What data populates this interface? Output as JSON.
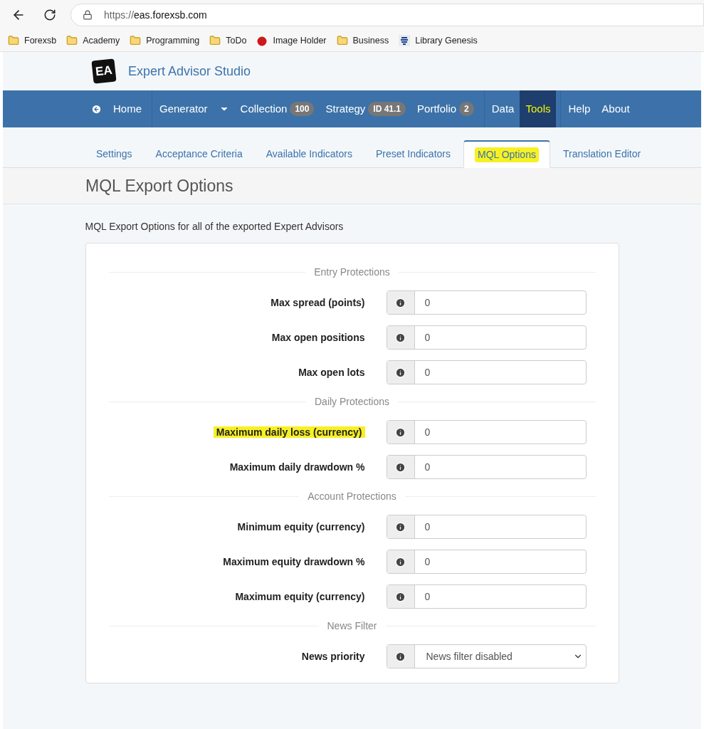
{
  "browser": {
    "url_scheme": "https://",
    "url_host": "eas.forexsb.com",
    "bookmarks": [
      {
        "label": "Forexsb",
        "kind": "folder"
      },
      {
        "label": "Academy",
        "kind": "folder"
      },
      {
        "label": "Programming",
        "kind": "folder"
      },
      {
        "label": "ToDo",
        "kind": "folder"
      },
      {
        "label": "Image Holder",
        "kind": "tomato"
      },
      {
        "label": "Business",
        "kind": "folder"
      },
      {
        "label": "Library Genesis",
        "kind": "stack"
      }
    ]
  },
  "app": {
    "title": "Expert Advisor Studio",
    "logo": "EA"
  },
  "nav": [
    [
      {
        "label": "Home",
        "kind": "back",
        "active": false,
        "highlighted": false
      }
    ],
    [
      {
        "label": "Generator",
        "dropdown": true,
        "active": false,
        "highlighted": false
      },
      {
        "label": "Collection",
        "badge": "100",
        "active": false,
        "highlighted": false
      },
      {
        "label": "Strategy",
        "badge": "ID 41.1",
        "active": false,
        "highlighted": false
      },
      {
        "label": "Portfolio",
        "badge": "2",
        "active": false,
        "highlighted": false
      }
    ],
    [
      {
        "label": "Data",
        "active": false,
        "highlighted": false
      },
      {
        "label": "Tools",
        "active": true,
        "highlighted": true
      }
    ],
    [
      {
        "label": "Help",
        "active": false,
        "highlighted": false
      },
      {
        "label": "About",
        "active": false,
        "highlighted": false
      }
    ]
  ],
  "tabs": [
    {
      "label": "Settings",
      "selected": false,
      "highlighted": false
    },
    {
      "label": "Acceptance Criteria",
      "selected": false,
      "highlighted": false
    },
    {
      "label": "Available Indicators",
      "selected": false,
      "highlighted": false
    },
    {
      "label": "Preset Indicators",
      "selected": false,
      "highlighted": false
    },
    {
      "label": "MQL Options",
      "selected": true,
      "highlighted": true
    },
    {
      "label": "Translation Editor",
      "selected": false,
      "highlighted": false
    }
  ],
  "page_title": "MQL Export Options",
  "description": "MQL Export Options for all of the exported Expert Advisors",
  "sections": [
    {
      "title": "Entry Protections",
      "fields": [
        {
          "label": "Max spread (points)",
          "value": "0",
          "kind": "number",
          "highlighted": false
        },
        {
          "label": "Max open positions",
          "value": "0",
          "kind": "number",
          "highlighted": false
        },
        {
          "label": "Max open lots",
          "value": "0",
          "kind": "number",
          "highlighted": false
        }
      ]
    },
    {
      "title": "Daily Protections",
      "fields": [
        {
          "label": "Maximum daily loss (currency)",
          "value": "0",
          "kind": "number",
          "highlighted": true
        },
        {
          "label": "Maximum daily drawdown %",
          "value": "0",
          "kind": "number",
          "highlighted": false
        }
      ]
    },
    {
      "title": "Account Protections",
      "fields": [
        {
          "label": "Minimum equity (currency)",
          "value": "0",
          "kind": "number",
          "highlighted": false
        },
        {
          "label": "Maximum equity drawdown %",
          "value": "0",
          "kind": "number",
          "highlighted": false
        },
        {
          "label": "Maximum equity (currency)",
          "value": "0",
          "kind": "number",
          "highlighted": false
        }
      ]
    },
    {
      "title": "News Filter",
      "fields": [
        {
          "label": "News priority",
          "value": "News filter disabled",
          "kind": "select",
          "highlighted": false
        }
      ]
    }
  ]
}
